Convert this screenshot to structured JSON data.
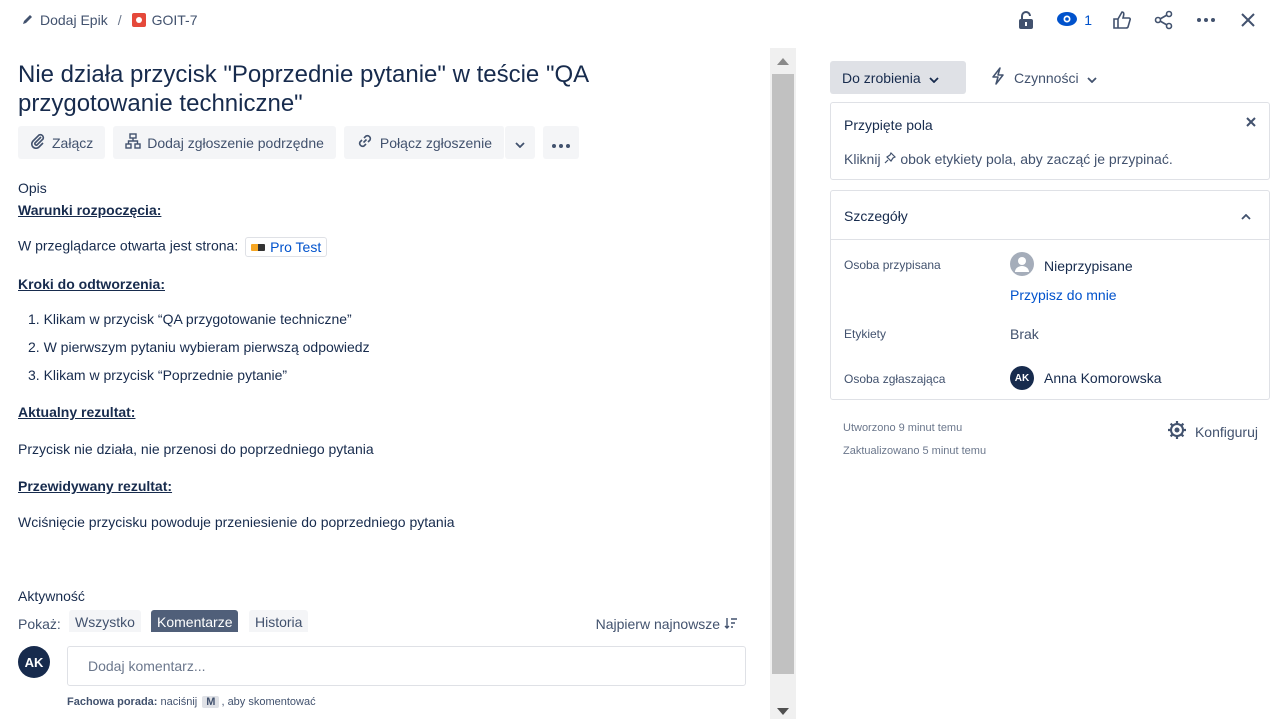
{
  "breadcrumb": {
    "epic_label": "Dodaj Epik",
    "separator": "/",
    "issue_key": "GOIT-7"
  },
  "header": {
    "watch_count": "1"
  },
  "issue": {
    "title": "Nie działa przycisk \"Poprzednie pytanie\" w teście \"QA przygotowanie techniczne\""
  },
  "actions": {
    "attach": "Załącz",
    "add_child": "Dodaj zgłoszenie podrzędne",
    "link_issue": "Połącz zgłoszenie"
  },
  "description": {
    "label": "Opis",
    "preconditions_heading": "Warunki rozpoczęcia:",
    "preconditions_text": "W przeglądarce otwarta jest strona:",
    "link_chip": "Pro Test",
    "steps_heading": "Kroki do odtworzenia:",
    "steps": [
      "1. Klikam w przycisk “QA przygotowanie techniczne”",
      "2. W pierwszym pytaniu wybieram pierwszą odpowiedz",
      "3. Klikam w przycisk “Poprzednie pytanie”"
    ],
    "actual_heading": "Aktualny rezultat:",
    "actual_text": "Przycisk nie działa, nie przenosi do poprzedniego pytania",
    "expected_heading": "Przewidywany rezultat:",
    "expected_text": "Wciśnięcie przycisku powoduje przeniesienie do poprzedniego pytania"
  },
  "activity": {
    "label": "Aktywność",
    "show_label": "Pokaż:",
    "filters": [
      "Wszystko",
      "Komentarze",
      "Historia"
    ],
    "active_filter": "Komentarze",
    "sort_label": "Najpierw najnowsze"
  },
  "comment": {
    "avatar_initials": "AK",
    "placeholder": "Dodaj komentarz...",
    "tip_bold": "Fachowa porada:",
    "tip_pre": "naciśnij",
    "tip_key": "M",
    "tip_post": ", aby skomentować"
  },
  "sidebar": {
    "status": "Do zrobienia",
    "actions_label": "Czynności",
    "pinned": {
      "title": "Przypięte pola",
      "text_before": "Kliknij",
      "text_after": "obok etykiety pola, aby zacząć je przypinać."
    },
    "details": {
      "title": "Szczegóły",
      "assignee_label": "Osoba przypisana",
      "assignee_value": "Nieprzypisane",
      "assign_me": "Przypisz do mnie",
      "labels_label": "Etykiety",
      "labels_value": "Brak",
      "reporter_label": "Osoba zgłaszająca",
      "reporter_initials": "AK",
      "reporter_name": "Anna Komorowska"
    },
    "created": "Utworzono 9 minut temu",
    "updated": "Zaktualizowano 5 minut temu",
    "configure": "Konfiguruj"
  },
  "icons": {
    "breadcrumb_epic": "pencil-icon",
    "issue_type": "bug-icon",
    "lock": "lock-icon",
    "watch": "eye-icon",
    "like": "thumbs-up-icon",
    "share": "share-icon",
    "more": "more-icon",
    "close": "close-icon"
  },
  "colors": {
    "link": "#0052cc",
    "text": "#172b4d",
    "bug": "#e5493a",
    "active_filter": "#505f79"
  }
}
